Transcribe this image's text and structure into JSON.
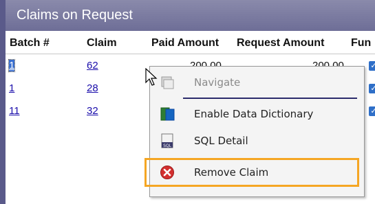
{
  "panel": {
    "title": "Claims on Request"
  },
  "columns": {
    "batch": "Batch #",
    "claim": "Claim",
    "paid_amount": "Paid Amount",
    "request_amount": "Request Amount",
    "funds": "Fun"
  },
  "rows": [
    {
      "batch": "1",
      "claim": "62",
      "paid": "200.00",
      "request": "200.00"
    },
    {
      "batch": "1",
      "claim": "28"
    },
    {
      "batch": "11",
      "claim": "32"
    }
  ],
  "context_menu": {
    "navigate": "Navigate",
    "enable_dd": "Enable Data Dictionary",
    "sql_detail": "SQL Detail",
    "remove_claim": "Remove Claim"
  },
  "colors": {
    "title_bar": "#7a7aa0",
    "highlight": "#f5a623",
    "link": "#1a0dab"
  }
}
